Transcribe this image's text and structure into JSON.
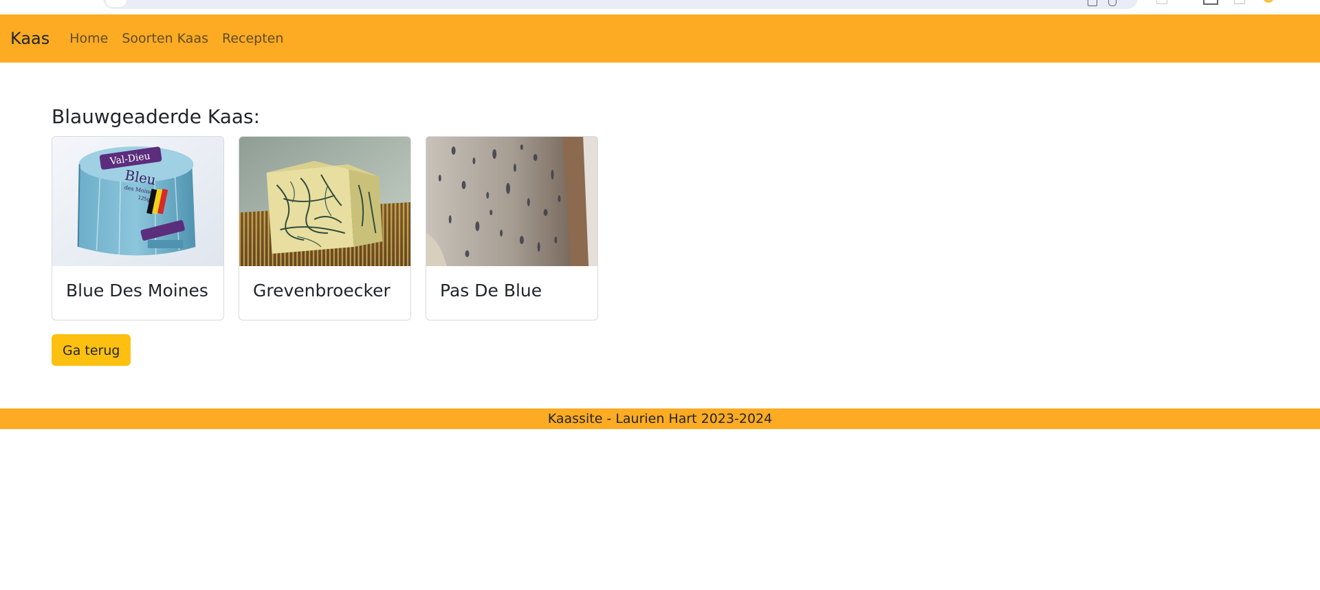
{
  "navbar": {
    "brand": "Kaas",
    "links": [
      {
        "label": "Home"
      },
      {
        "label": "Soorten Kaas"
      },
      {
        "label": "Recepten"
      }
    ]
  },
  "main": {
    "heading": "Blauwgeaderde Kaas:",
    "cards": [
      {
        "title": "Blue Des Moines",
        "label_brand": "Val-Dieu",
        "label_name": "Bleu",
        "label_sub": "des Moines",
        "label_weight": "125g"
      },
      {
        "title": "Grevenbroecker"
      },
      {
        "title": "Pas De Blue"
      }
    ],
    "back_button": "Ga terug"
  },
  "footer": {
    "text": "Kaassite - Laurien Hart 2023-2024"
  },
  "colors": {
    "navbar": "#fdab22",
    "footer": "#fdab22",
    "button": "#fdc010",
    "text": "#212529"
  }
}
